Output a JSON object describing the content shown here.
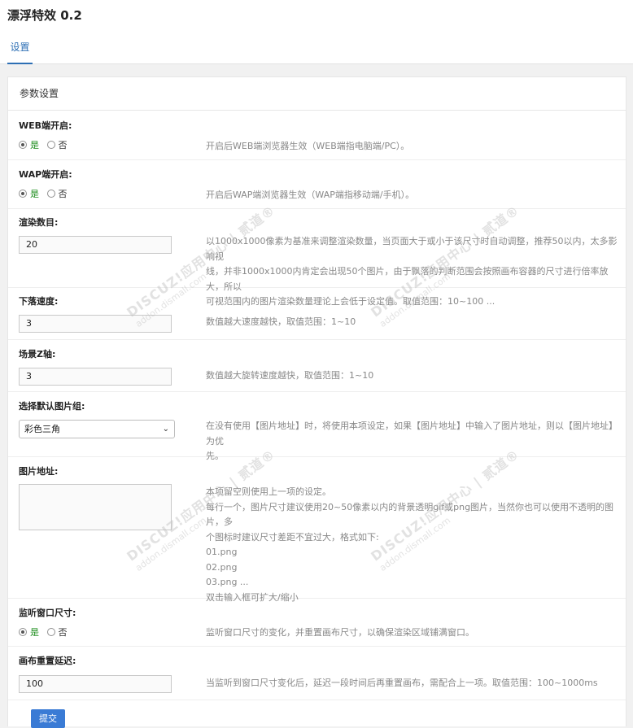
{
  "app": {
    "title": "漂浮特效 0.2"
  },
  "tabs": [
    {
      "label": "设置"
    }
  ],
  "panel": {
    "title": "参数设置"
  },
  "fields": {
    "web": {
      "label": "WEB端开启:",
      "yes": "是",
      "no": "否",
      "selected": "yes",
      "desc": "开启后WEB端浏览器生效（WEB端指电脑端/PC）。"
    },
    "wap": {
      "label": "WAP端开启:",
      "yes": "是",
      "no": "否",
      "selected": "yes",
      "desc": "开启后WAP端浏览器生效（WAP端指移动端/手机）。"
    },
    "count": {
      "label": "渲染数目:",
      "value": "20",
      "desc_lines": [
        "以1000x1000像素为基准来调整渲染数量，当页面大于或小于该尺寸时自动调整，推荐50以内，太多影响视",
        "线，并非1000x1000内肯定会出现50个图片，由于飘落的判断范围会按照画布容器的尺寸进行倍率放大，所以",
        "可视范围内的图片渲染数量理论上会低于设定值。取值范围：10~100 ..."
      ]
    },
    "speed": {
      "label": "下落速度:",
      "value": "3",
      "desc": "数值越大速度越快，取值范围：1~10"
    },
    "zaxis": {
      "label": "场景Z轴:",
      "value": "3",
      "desc": "数值越大旋转速度越快，取值范围：1~10"
    },
    "group": {
      "label": "选择默认图片组:",
      "value": "彩色三角",
      "desc_lines": [
        "在没有使用【图片地址】时，将使用本项设定，如果【图片地址】中输入了图片地址，则以【图片地址】为优",
        "先。"
      ]
    },
    "images": {
      "label": "图片地址:",
      "value": "",
      "desc_lines": [
        "本项留空则使用上一项的设定。",
        "每行一个，图片尺寸建议使用20~50像素以内的背景透明gif或png图片，当然你也可以使用不透明的图片，多",
        "个图标时建议尺寸差距不宜过大，格式如下:",
        "01.png",
        "02.png",
        "03.png ...",
        "双击输入框可扩大/缩小"
      ]
    },
    "resize": {
      "label": "监听窗口尺寸:",
      "yes": "是",
      "no": "否",
      "selected": "yes",
      "desc": "监听窗口尺寸的变化，并重置画布尺寸，以确保渲染区域铺满窗口。"
    },
    "delay": {
      "label": "画布重置延迟:",
      "value": "100",
      "desc": "当监听到窗口尺寸变化后，延迟一段时间后再重置画布，需配合上一项。取值范围：100~1000ms"
    }
  },
  "submit_label": "提交",
  "watermark": {
    "text": "DISCUZ!应用中心 | 贰道®",
    "sub": "addon.dismall.com"
  },
  "colors": {
    "accent": "#2d6fb4",
    "button": "#3a7bd5",
    "radio_selected_text": "#1b8c1b"
  }
}
